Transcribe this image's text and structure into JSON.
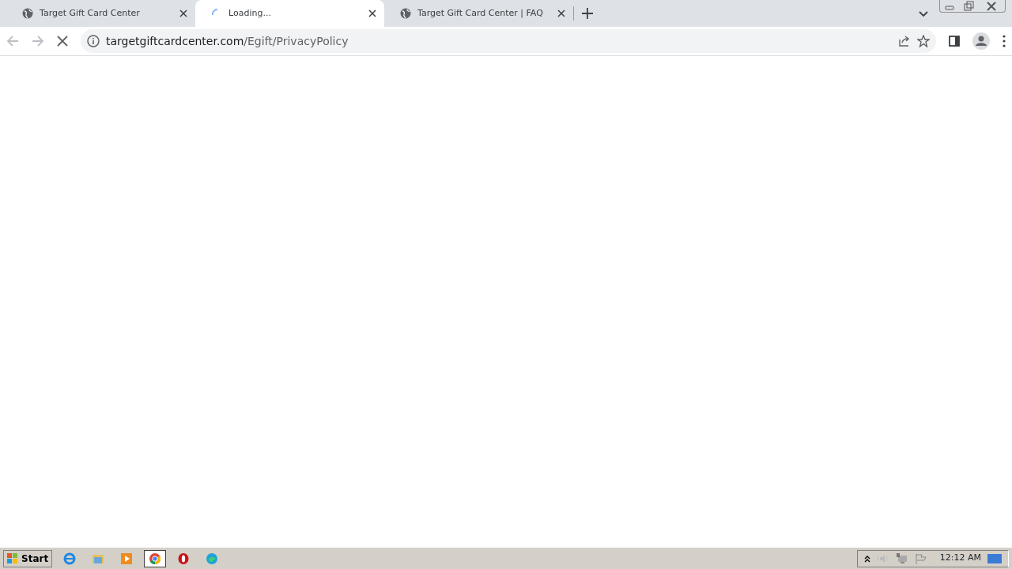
{
  "tabs": [
    {
      "title": "Target Gift Card Center",
      "selected": false,
      "kind": "globe"
    },
    {
      "title": "Loading...",
      "selected": true,
      "kind": "loading"
    },
    {
      "title": "Target Gift Card Center | FAQ",
      "selected": false,
      "kind": "globe"
    }
  ],
  "address_bar": {
    "host": "targetgiftcardcenter.com",
    "path": "/Egift/PrivacyPolicy",
    "loading": true
  },
  "taskbar": {
    "start_label": "Start",
    "apps": [
      {
        "kind": "ie",
        "selected": false
      },
      {
        "kind": "folder",
        "selected": false
      },
      {
        "kind": "media",
        "selected": false
      },
      {
        "kind": "chrome",
        "selected": true
      },
      {
        "kind": "opera",
        "selected": false
      },
      {
        "kind": "edge",
        "selected": false
      }
    ],
    "clock": "12:12 AM"
  }
}
